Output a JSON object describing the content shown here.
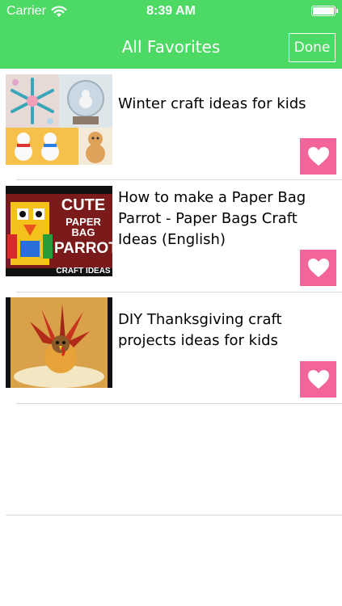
{
  "status_bar": {
    "carrier": "Carrier",
    "time": "8:39 AM",
    "icons": [
      "wifi-icon",
      "battery-icon"
    ]
  },
  "nav": {
    "title": "All Favorites",
    "done_label": "Done"
  },
  "colors": {
    "header": "#4cd964",
    "heart_button": "#f2649a",
    "separator": "#d9d9d9",
    "text": "#000000"
  },
  "favorites": [
    {
      "title": "Winter craft ideas for kids",
      "icon": "heart-icon"
    },
    {
      "title": "How to make a Paper Bag Parrot - Paper Bags Craft Ideas (English)",
      "icon": "heart-icon",
      "thumbnail_text": [
        "CUTE",
        "PAPER BAG",
        "PARROT",
        "CRAFT IDEAS"
      ]
    },
    {
      "title": "DIY Thanksgiving craft projects ideas for kids",
      "icon": "heart-icon"
    }
  ]
}
